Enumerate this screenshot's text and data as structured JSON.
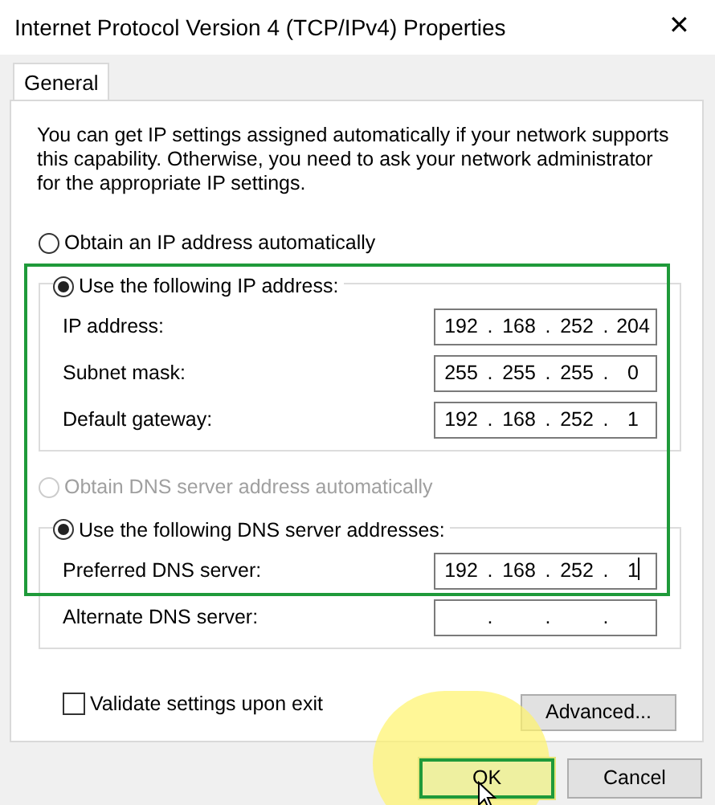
{
  "window": {
    "title": "Internet Protocol Version 4 (TCP/IPv4) Properties",
    "close": "✕"
  },
  "tabs": [
    {
      "label": "General",
      "selected": true
    }
  ],
  "intro": "You can get IP settings assigned automatically if your network supports this capability. Otherwise, you need to ask your network administrator for the appropriate IP settings.",
  "ip_auto": {
    "label": "Obtain an IP address automatically",
    "selected": false,
    "disabled": false
  },
  "ip_static": {
    "label": "Use the following IP address:",
    "selected": true,
    "disabled": false,
    "highlighted": true,
    "fields": [
      {
        "label": "IP address:",
        "octets": [
          "192",
          "168",
          "252",
          "204"
        ],
        "dots": [
          ".",
          ".",
          "."
        ]
      },
      {
        "label": "Subnet mask:",
        "octets": [
          "255",
          "255",
          "255",
          "0"
        ],
        "dots": [
          ".",
          ".",
          "."
        ]
      },
      {
        "label": "Default gateway:",
        "octets": [
          "192",
          "168",
          "252",
          "1"
        ],
        "dots": [
          ".",
          ".",
          "."
        ]
      }
    ]
  },
  "dns_auto": {
    "label": "Obtain DNS server address automatically",
    "selected": false,
    "disabled": true
  },
  "dns_static": {
    "label": "Use the following DNS server addresses:",
    "selected": true,
    "disabled": false,
    "fields": [
      {
        "label": "Preferred DNS server:",
        "octets": [
          "192",
          "168",
          "252",
          "1"
        ],
        "dots": [
          ".",
          ".",
          "."
        ],
        "focused": true
      },
      {
        "label": "Alternate DNS server:",
        "dots": [
          ".",
          ".",
          "."
        ],
        "focused": false
      }
    ]
  },
  "validate": {
    "label": "Validate settings upon exit",
    "checked": false
  },
  "advanced_button": "Advanced...",
  "buttons": [
    {
      "label": "OK",
      "highlighted": true
    },
    {
      "label": "Cancel",
      "highlighted": false
    }
  ]
}
